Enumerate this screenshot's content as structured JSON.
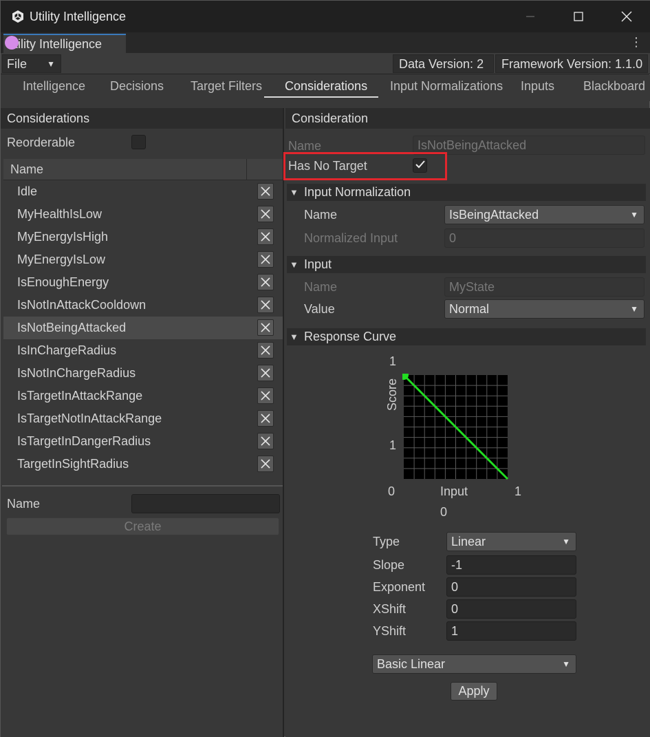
{
  "window": {
    "title": "Utility Intelligence",
    "doc_tab": "tility Intelligence"
  },
  "toolbar": {
    "file_label": "File",
    "data_version": "Data Version: 2",
    "framework_version": "Framework Version: 1.1.0"
  },
  "nav_tabs": [
    "Intelligence",
    "Decisions",
    "Target Filters",
    "Considerations",
    "Input Normalizations",
    "Inputs",
    "Blackboard"
  ],
  "active_tab": "Considerations",
  "left": {
    "header": "Considerations",
    "reorderable_label": "Reorderable",
    "reorderable_checked": false,
    "column_name": "Name",
    "items": [
      "Idle",
      "MyHealthIsLow",
      "MyEnergyIsHigh",
      "MyEnergyIsLow",
      "IsEnoughEnergy",
      "IsNotInAttackCooldown",
      "IsNotBeingAttacked",
      "IsInChargeRadius",
      "IsNotInChargeRadius",
      "IsTargetInAttackRange",
      "IsTargetNotInAttackRange",
      "IsTargetInDangerRadius",
      "TargetInSightRadius"
    ],
    "selected_item": "IsNotBeingAttacked",
    "name_label": "Name",
    "name_value": "",
    "create_label": "Create"
  },
  "right": {
    "header": "Consideration",
    "name_label": "Name",
    "name_value": "IsNotBeingAttacked",
    "has_no_target_label": "Has No Target",
    "has_no_target_checked": true,
    "input_normalization": {
      "header": "Input Normalization",
      "name_label": "Name",
      "name_value": "IsBeingAttacked",
      "normalized_label": "Normalized Input",
      "normalized_value": "0"
    },
    "input": {
      "header": "Input",
      "name_label": "Name",
      "name_value": "MyState",
      "value_label": "Value",
      "value_value": "Normal"
    },
    "response_curve": {
      "header": "Response Curve",
      "y_top": "1",
      "y_mid": "1",
      "y_axis": "Score",
      "x_left": "0",
      "x_right": "1",
      "x_axis": "Input",
      "x_input_value": "0",
      "type_label": "Type",
      "type_value": "Linear",
      "slope_label": "Slope",
      "slope_value": "-1",
      "exponent_label": "Exponent",
      "exponent_value": "0",
      "xshift_label": "XShift",
      "xshift_value": "0",
      "yshift_label": "YShift",
      "yshift_value": "1",
      "preset_value": "Basic Linear",
      "apply_label": "Apply"
    }
  },
  "colors": {
    "highlight": "#e1262d",
    "curve": "#22dd22",
    "accent_tab": "#3a79bb"
  },
  "chart_data": {
    "type": "line",
    "x": [
      0,
      1
    ],
    "y": [
      1,
      0
    ],
    "xlim": [
      0,
      1
    ],
    "ylim": [
      0,
      1
    ],
    "grid": true
  }
}
